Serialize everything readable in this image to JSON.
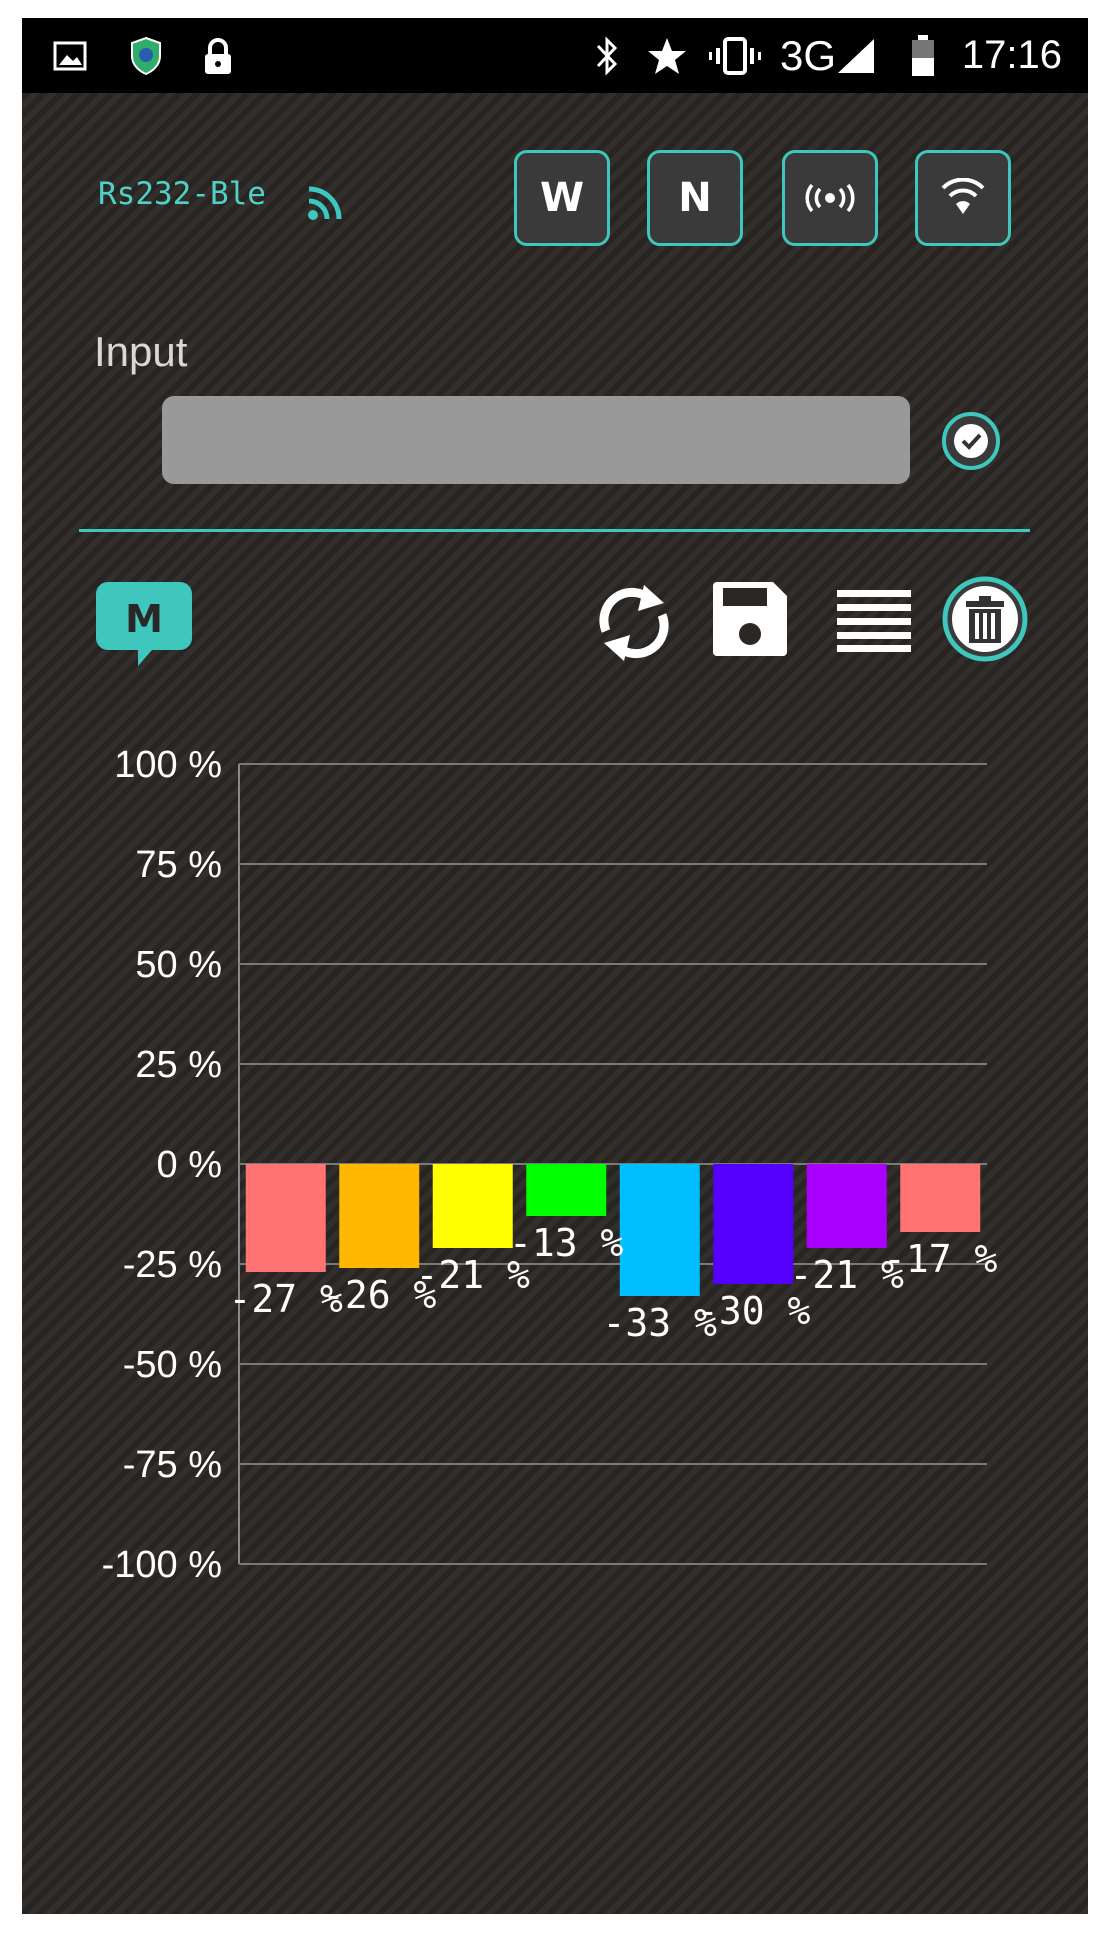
{
  "status_bar": {
    "time": "17:16",
    "network": "3G",
    "icons": [
      "image-icon",
      "shield-icon",
      "lock-icon",
      "bluetooth-icon",
      "star-icon",
      "vibrate-icon",
      "signal-icon",
      "battery-icon"
    ]
  },
  "header": {
    "title": "Rs232-Ble",
    "buttons": [
      {
        "label": "W",
        "icon": "w-icon"
      },
      {
        "label": "N",
        "icon": "n-icon"
      },
      {
        "label": "",
        "icon": "broadcast-icon"
      },
      {
        "label": "",
        "icon": "wifi-icon"
      }
    ]
  },
  "input": {
    "label": "Input",
    "value": "",
    "placeholder": ""
  },
  "toolbar": {
    "mode_badge": "M",
    "icons": [
      "refresh-icon",
      "save-icon",
      "list-icon",
      "trash-icon"
    ]
  },
  "colors": {
    "accent": "#3fc7bd",
    "background": "#2b2725"
  },
  "chart_data": {
    "type": "bar",
    "ylim": [
      -100,
      100
    ],
    "yticks": [
      100,
      75,
      50,
      25,
      0,
      -25,
      -50,
      -75,
      -100
    ],
    "ytick_labels": [
      "100 %",
      "75 %",
      "50 %",
      "25 %",
      "0 %",
      "-25 %",
      "-50 %",
      "-75 %",
      "-100 %"
    ],
    "values": [
      -27,
      -26,
      -21,
      -13,
      -33,
      -30,
      -21,
      -17
    ],
    "data_labels": [
      "-27 %",
      "-26 %",
      "-21 %",
      "-13 %",
      "-33 %",
      "-30 %",
      "-21 %",
      "-17 %"
    ],
    "bar_colors": [
      "#ff7373",
      "#ffb800",
      "#ffff00",
      "#00ff00",
      "#00bfff",
      "#5500ff",
      "#aa00ff",
      "#ff7373"
    ],
    "grid": true,
    "legend": "none"
  }
}
